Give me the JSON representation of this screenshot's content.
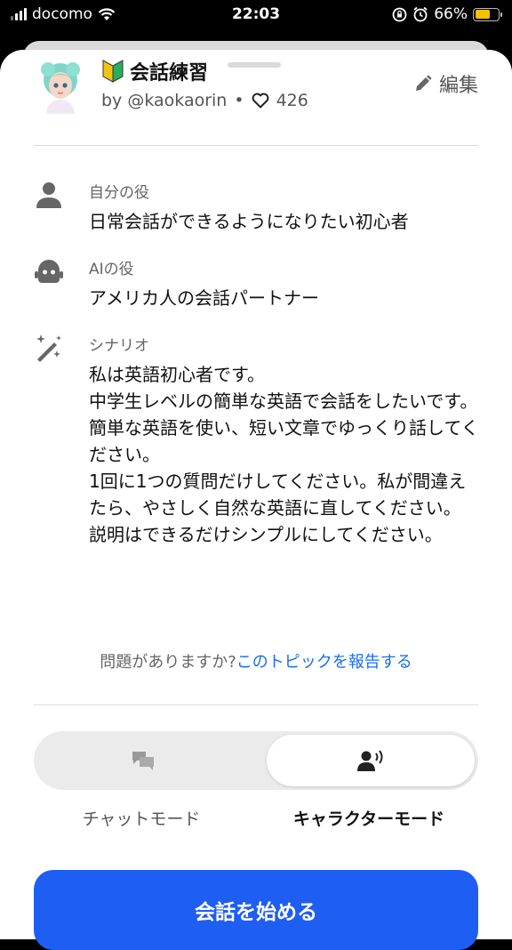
{
  "status_bar": {
    "carrier": "docomo",
    "time": "22:03",
    "battery": "66%",
    "battery_level": 0.66
  },
  "header": {
    "title": "会話練習",
    "author": "by @kaokaorin",
    "separator": "•",
    "likes": "426",
    "edit_label": "編集"
  },
  "roles": {
    "self": {
      "label": "自分の役",
      "value": "日常会話ができるようになりたい初心者",
      "icon": "person-icon"
    },
    "ai": {
      "label": "AIの役",
      "value": "アメリカ人の会話パートナー",
      "icon": "robot-icon"
    },
    "scenario": {
      "label": "シナリオ",
      "icon": "magic-wand-icon",
      "value": "私は英語初心者です。\n中学生レベルの簡単な英語で会話をしたいです。\n簡単な英語を使い、短い文章でゆっくり話してください。\n1回に1つの質問だけしてください。私が間違えたら、やさしく自然な英語に直してください。\n説明はできるだけシンプルにしてください。"
    }
  },
  "report": {
    "question": "問題がありますか?",
    "link": "このトピックを報告する"
  },
  "modes": {
    "chat_label": "チャットモード",
    "character_label": "キャラクターモード",
    "selected": "character"
  },
  "start_button": {
    "label": "会話を始める"
  },
  "colors": {
    "accent": "#1f5ef2",
    "link": "#1a6ef0",
    "battery": "#f2c200"
  }
}
